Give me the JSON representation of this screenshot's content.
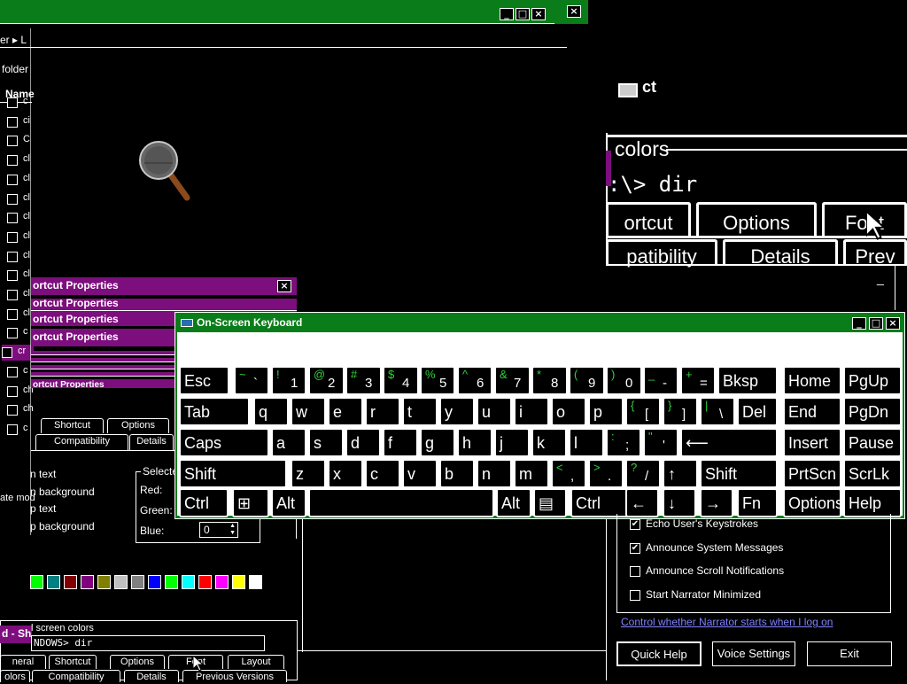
{
  "explorer": {
    "address_fragment": "er ▸ L",
    "folder_label": "folder",
    "column_name": "Name",
    "files": [
      "c",
      "ci",
      "C",
      "cl",
      "cl",
      "cl",
      "cl",
      "cl",
      "cl",
      "cl",
      "cl",
      "cl",
      "c",
      "cr",
      "c",
      "ch",
      "ch",
      "c"
    ]
  },
  "shortcut_props": {
    "title_1": "ortcut Properties",
    "title_2": "ortcut Properties",
    "title_3": "ortcut Properties",
    "title_4": "ortcut Properties",
    "title_5": "ortcut Properties",
    "tabs_row1": [
      "Shortcut",
      "Options"
    ],
    "tabs_row2": [
      "Compatibility",
      "Details"
    ],
    "radio_labels": [
      "n text",
      "n background",
      "p text",
      "p background"
    ],
    "mode_fragment": "ate mod",
    "selected_group": "Selecte",
    "red_label": "Red:",
    "green_label": "Green:",
    "blue_label": "Blue:",
    "blue_value": "0",
    "palette": [
      "#00ff00",
      "#008080",
      "#800000",
      "#800080",
      "#808000",
      "#c0c0c0",
      "#808080",
      "#0000ff",
      "#00ff00",
      "#00ffff",
      "#ff0000",
      "#ff00ff",
      "#ffff00",
      "#ffffff"
    ]
  },
  "cmd_bottom": {
    "title_fragment": "d - Sh",
    "screen_colors": "l screen colors",
    "prompt": "NDOWS> dir",
    "tabs_row1": [
      "neral",
      "Shortcut",
      "Options",
      "Font",
      "Layout"
    ],
    "tabs_row2": [
      "olors",
      "Compatibility",
      "Details",
      "Previous Versions"
    ]
  },
  "zoomed": {
    "colors_label": "colors",
    "prompt": ":\\> dir",
    "tabs_row1": [
      "ortcut",
      "Options",
      "Font"
    ],
    "tabs_row2": [
      "patibility",
      "Details",
      "Prev"
    ],
    "check_fragment": "ct",
    "minimize_glyph": "_"
  },
  "osk": {
    "title": "On-Screen Keyboard",
    "controls": [
      "_",
      "□",
      "×"
    ],
    "rows": [
      [
        {
          "k": "Esc"
        },
        {
          "t": "~",
          "b": "`"
        },
        {
          "t": "!",
          "b": "1"
        },
        {
          "t": "@",
          "b": "2"
        },
        {
          "t": "#",
          "b": "3"
        },
        {
          "t": "$",
          "b": "4"
        },
        {
          "t": "%",
          "b": "5"
        },
        {
          "t": "^",
          "b": "6"
        },
        {
          "t": "&",
          "b": "7"
        },
        {
          "t": "*",
          "b": "8"
        },
        {
          "t": "(",
          "b": "9"
        },
        {
          "t": ")",
          "b": "0"
        },
        {
          "t": "_",
          "b": "-"
        },
        {
          "t": "+",
          "b": "="
        },
        {
          "k": "Bksp"
        },
        {
          "k": "Home"
        },
        {
          "k": "PgUp"
        }
      ],
      [
        {
          "k": "Tab"
        },
        {
          "k": "q"
        },
        {
          "k": "w"
        },
        {
          "k": "e"
        },
        {
          "k": "r"
        },
        {
          "k": "t"
        },
        {
          "k": "y"
        },
        {
          "k": "u"
        },
        {
          "k": "i"
        },
        {
          "k": "o"
        },
        {
          "k": "p"
        },
        {
          "t": "{",
          "b": "["
        },
        {
          "t": "}",
          "b": "]"
        },
        {
          "t": "|",
          "b": "\\"
        },
        {
          "k": "Del"
        },
        {
          "k": "End"
        },
        {
          "k": "PgDn"
        }
      ],
      [
        {
          "k": "Caps"
        },
        {
          "k": "a"
        },
        {
          "k": "s"
        },
        {
          "k": "d"
        },
        {
          "k": "f"
        },
        {
          "k": "g"
        },
        {
          "k": "h"
        },
        {
          "k": "j"
        },
        {
          "k": "k"
        },
        {
          "k": "l"
        },
        {
          "t": ":",
          "b": ";"
        },
        {
          "t": "\"",
          "b": "'"
        },
        {
          "k": "⟵"
        },
        {
          "k": "Insert"
        },
        {
          "k": "Pause"
        }
      ],
      [
        {
          "k": "Shift"
        },
        {
          "k": "z"
        },
        {
          "k": "x"
        },
        {
          "k": "c"
        },
        {
          "k": "v"
        },
        {
          "k": "b"
        },
        {
          "k": "n"
        },
        {
          "k": "m"
        },
        {
          "t": "<",
          "b": ","
        },
        {
          "t": ">",
          "b": "."
        },
        {
          "t": "?",
          "b": "/"
        },
        {
          "k": "↑"
        },
        {
          "k": "Shift"
        },
        {
          "k": "PrtScn"
        },
        {
          "k": "ScrLk"
        }
      ],
      [
        {
          "k": "Ctrl"
        },
        {
          "k": "⊞"
        },
        {
          "k": "Alt"
        },
        {
          "k": ""
        },
        {
          "k": "Alt"
        },
        {
          "k": "▤"
        },
        {
          "k": "Ctrl"
        },
        {
          "k": "←"
        },
        {
          "k": "↓"
        },
        {
          "k": "→"
        },
        {
          "k": "Fn"
        },
        {
          "k": "Options"
        },
        {
          "k": "Help"
        }
      ]
    ]
  },
  "narrator": {
    "options": [
      {
        "label": "Echo User's Keystrokes",
        "checked": true
      },
      {
        "label": "Announce System Messages",
        "checked": true
      },
      {
        "label": "Announce Scroll Notifications",
        "checked": false
      },
      {
        "label": "Start Narrator Minimized",
        "checked": false
      }
    ],
    "link": "Control whether Narrator starts when I log on",
    "buttons": [
      "Quick Help",
      "Voice Settings",
      "Exit"
    ]
  },
  "magnifier": {
    "icon": "magnifier-icon"
  }
}
